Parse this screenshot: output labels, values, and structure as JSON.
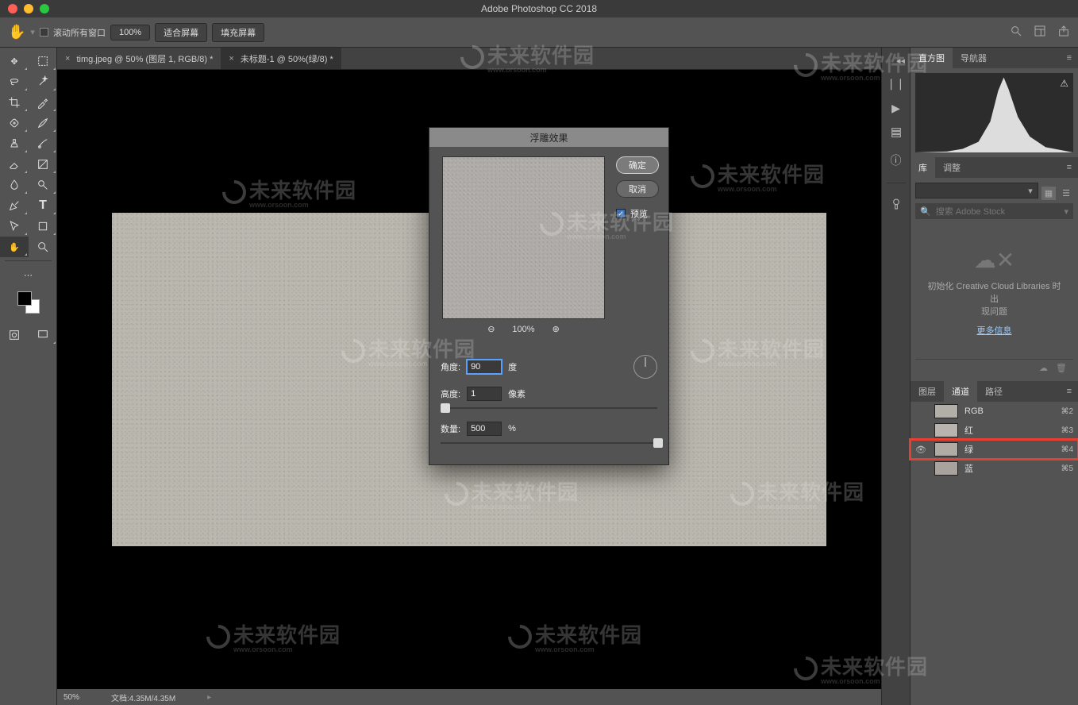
{
  "titlebar": {
    "title": "Adobe Photoshop CC 2018"
  },
  "options": {
    "scroll_all": "滚动所有窗口",
    "zoom_value": "100%",
    "fit_screen": "适合屏幕",
    "fill_screen": "填充屏幕"
  },
  "tabs": [
    {
      "label": "timg.jpeg @ 50% (图层 1, RGB/8) *",
      "active": false
    },
    {
      "label": "未标题-1 @ 50%(绿/8) *",
      "active": true
    }
  ],
  "status": {
    "zoom": "50%",
    "doc": "文档:4.35M/4.35M"
  },
  "dock_icons": [
    "bars",
    "play",
    "chart",
    "info",
    "user"
  ],
  "panel1_tabs": [
    "直方图",
    "导航器"
  ],
  "panel2_tabs": [
    "库",
    "调整"
  ],
  "library": {
    "search_placeholder": "搜索 Adobe Stock",
    "error_line1": "初始化 Creative Cloud Libraries 时出",
    "error_line2": "现问题",
    "more": "更多信息"
  },
  "panel3_tabs": [
    "图层",
    "通道",
    "路径"
  ],
  "channels": [
    {
      "name": "RGB",
      "shortcut": "⌘2",
      "eye": false
    },
    {
      "name": "红",
      "shortcut": "⌘3",
      "eye": false
    },
    {
      "name": "绿",
      "shortcut": "⌘4",
      "eye": true,
      "hilite": true
    },
    {
      "name": "蓝",
      "shortcut": "⌘5",
      "eye": false
    }
  ],
  "dialog": {
    "title": "浮雕效果",
    "ok": "确定",
    "cancel": "取消",
    "preview_label": "预览",
    "zoom_pct": "100%",
    "angle_label": "角度:",
    "angle_value": "90",
    "angle_unit": "度",
    "height_label": "高度:",
    "height_value": "1",
    "height_unit": "像素",
    "amount_label": "数量:",
    "amount_value": "500",
    "amount_unit": "%"
  },
  "watermark_text": "未来软件园",
  "watermark_sub": "www.orsoon.com"
}
